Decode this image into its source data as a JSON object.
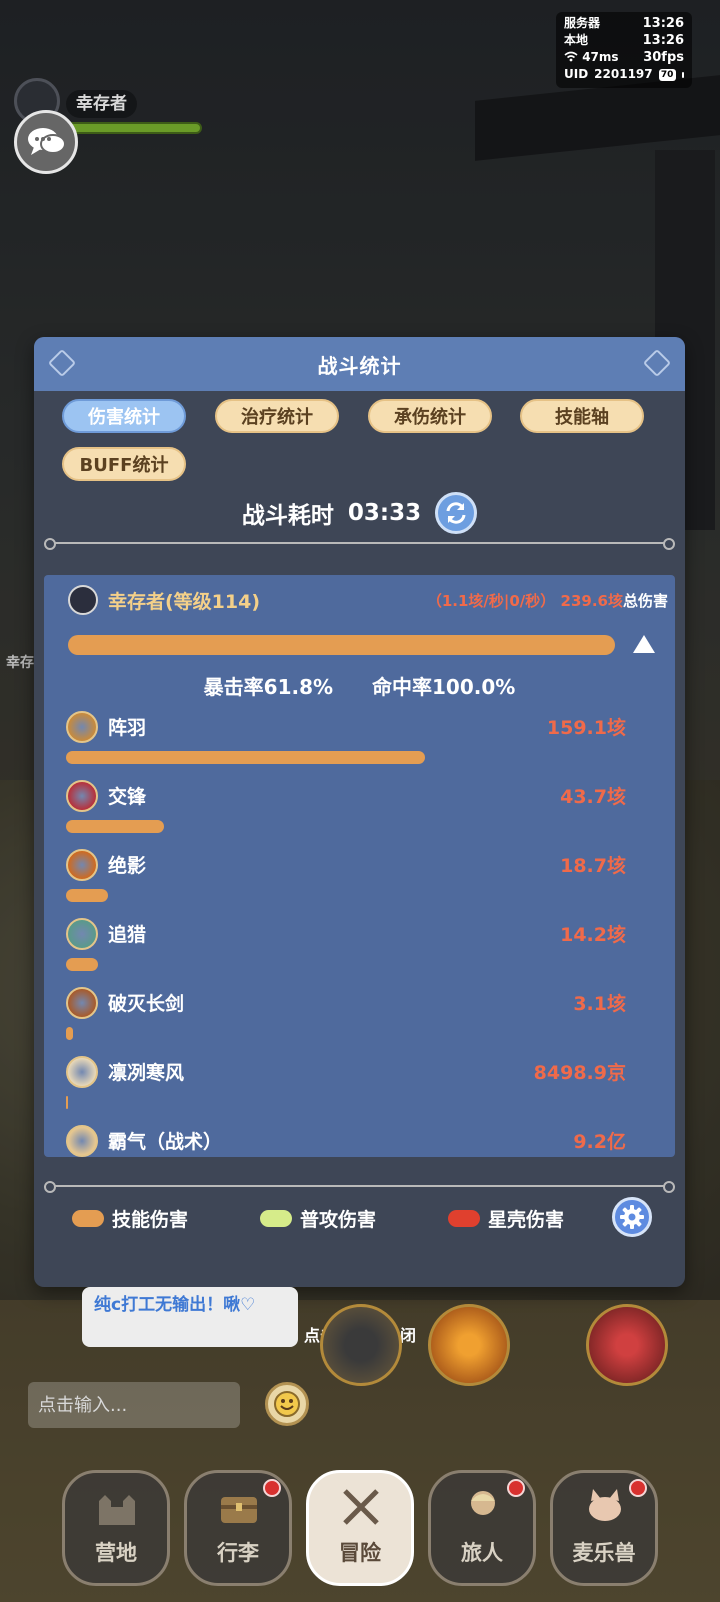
{
  "status": {
    "server_label": "服务器",
    "server_time": "13:26",
    "local_label": "本地",
    "local_time": "13:26",
    "ping": "47ms",
    "fps": "30fps",
    "uid_label": "UID",
    "uid": "2201197",
    "battery": "70"
  },
  "player": {
    "name": "幸存者"
  },
  "side_tag": "幸存",
  "dialog": {
    "title": "战斗统计",
    "tabs": [
      {
        "label": "伤害统计",
        "active": true
      },
      {
        "label": "治疗统计",
        "active": false
      },
      {
        "label": "承伤统计",
        "active": false
      },
      {
        "label": "技能轴",
        "active": false
      },
      {
        "label": "BUFF统计",
        "active": false
      }
    ],
    "duration_label": "战斗耗时",
    "duration_value": "03:33",
    "summary": {
      "name": "幸存者(等级114)",
      "rate": "（1.1垓/秒|0/秒）",
      "total": "239.6垓",
      "total_label": "总伤害",
      "bar_fraction": 1.0
    },
    "crit": "暴击率61.8%",
    "hit": "命中率100.0%",
    "skills": [
      {
        "name": "阵羽",
        "value": "159.1垓",
        "fraction": 0.664,
        "color": "#c98a3a"
      },
      {
        "name": "交锋",
        "value": "43.7垓",
        "fraction": 0.182,
        "color": "#b8303a"
      },
      {
        "name": "绝影",
        "value": "18.7垓",
        "fraction": 0.078,
        "color": "#d06a1e"
      },
      {
        "name": "追猎",
        "value": "14.2垓",
        "fraction": 0.059,
        "color": "#5a9a8a"
      },
      {
        "name": "破灭长剑",
        "value": "3.1垓",
        "fraction": 0.013,
        "color": "#a85a2a"
      },
      {
        "name": "凛冽寒风",
        "value": "8498.9京",
        "fraction": 0.004,
        "color": "#e8d8b8"
      },
      {
        "name": "霸气（战术）",
        "value": "9.2亿",
        "fraction": 0.0,
        "color": "#e8c890"
      }
    ],
    "legend": [
      {
        "label": "技能伤害",
        "color": "#e49d52"
      },
      {
        "label": "普攻伤害",
        "color": "#d6ec8a"
      },
      {
        "label": "星壳伤害",
        "color": "#e0402e"
      }
    ]
  },
  "chat_bubble": "纯c打工无输出！啾♡",
  "close_hint": "点击空白处关闭",
  "chat_input_placeholder": "点击输入...",
  "nav": [
    {
      "label": "营地",
      "active": false,
      "dot": false
    },
    {
      "label": "行李",
      "active": false,
      "dot": true
    },
    {
      "label": "冒险",
      "active": true,
      "dot": false
    },
    {
      "label": "旅人",
      "active": false,
      "dot": true
    },
    {
      "label": "麦乐兽",
      "active": false,
      "dot": true
    }
  ]
}
